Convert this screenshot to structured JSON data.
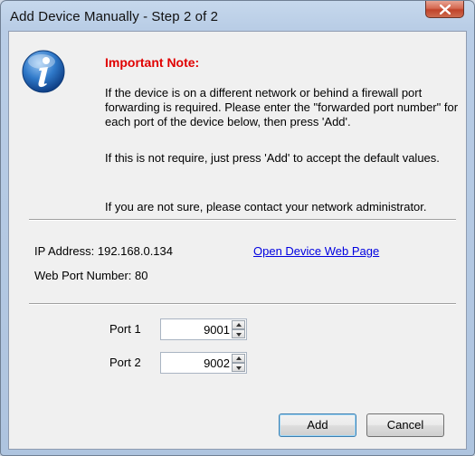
{
  "window": {
    "title": "Add Device Manually - Step 2 of 2"
  },
  "note": {
    "heading": "Important Note:",
    "paragraph1": "If the device is on a different network or behind a firewall port forwarding is required. Please enter the \"forwarded port number\" for each port of the device below, then press 'Add'.",
    "paragraph2": "If this is not require, just press 'Add' to accept the default values.",
    "paragraph3": "If you are not sure, please contact your network administrator."
  },
  "device": {
    "ip_label": "IP Address: 192.168.0.134",
    "web_port_label": "Web Port Number: 80",
    "open_link": "Open Device Web Page"
  },
  "ports": [
    {
      "label": "Port 1",
      "value": "9001"
    },
    {
      "label": "Port 2",
      "value": "9002"
    }
  ],
  "buttons": {
    "add": "Add",
    "cancel": "Cancel"
  },
  "icons": {
    "close": "close-icon",
    "info": "info-icon"
  }
}
